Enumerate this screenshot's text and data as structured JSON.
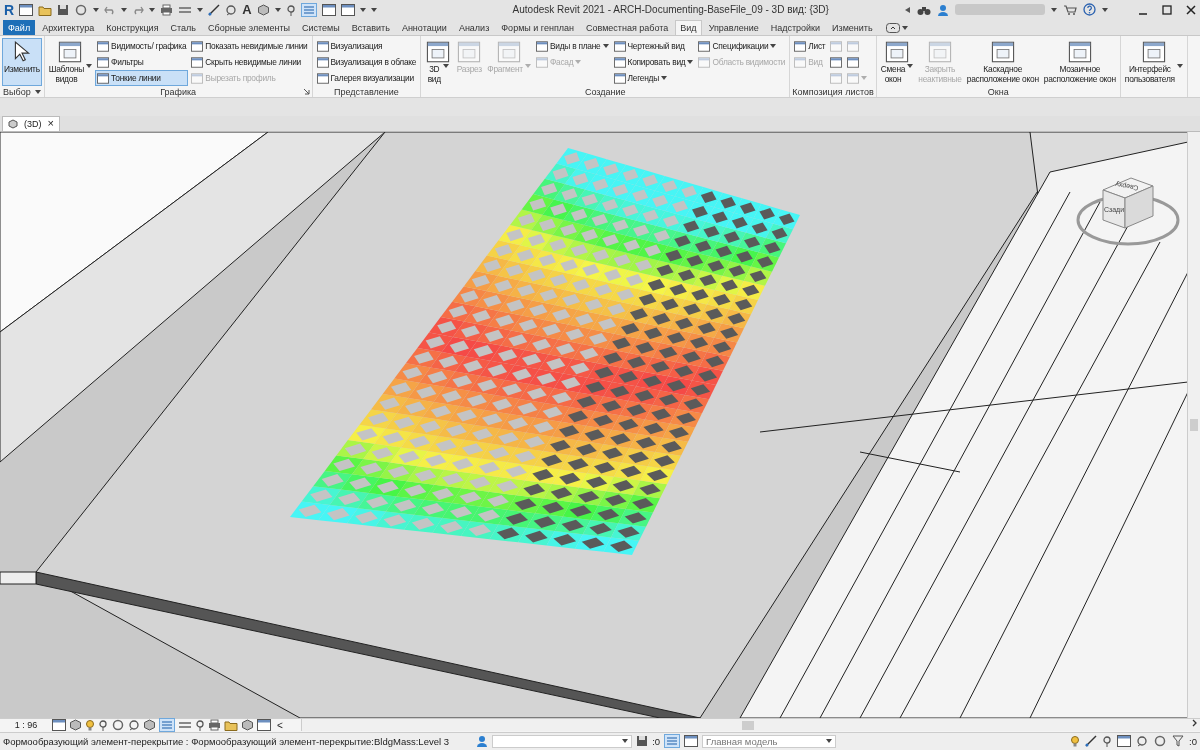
{
  "title_bar": {
    "logo": "R",
    "glyph": "A",
    "title": "Autodesk Revit 2021 - ARCH-Documenting-BaseFile_09 - 3D вид: {3D}"
  },
  "tabs": [
    {
      "kind": "file",
      "label": "Файл",
      "selected": false
    },
    {
      "kind": "tab",
      "label": "Архитектура",
      "selected": false
    },
    {
      "kind": "tab",
      "label": "Конструкция",
      "selected": false
    },
    {
      "kind": "tab",
      "label": "Сталь",
      "selected": false
    },
    {
      "kind": "tab",
      "label": "Сборные элементы",
      "selected": false
    },
    {
      "kind": "tab",
      "label": "Системы",
      "selected": false
    },
    {
      "kind": "tab",
      "label": "Вставить",
      "selected": false
    },
    {
      "kind": "tab",
      "label": "Аннотации",
      "selected": false
    },
    {
      "kind": "tab",
      "label": "Анализ",
      "selected": false
    },
    {
      "kind": "tab",
      "label": "Формы и генплан",
      "selected": false
    },
    {
      "kind": "tab",
      "label": "Совместная работа",
      "selected": false
    },
    {
      "kind": "tab",
      "label": "Вид",
      "selected": true
    },
    {
      "kind": "tab",
      "label": "Управление",
      "selected": false
    },
    {
      "kind": "tab",
      "label": "Надстройки",
      "selected": false
    },
    {
      "kind": "tab",
      "label": "Изменить",
      "selected": false
    }
  ],
  "ribbon": {
    "panels": [
      {
        "title": "Выбор",
        "menu": true,
        "launcher": false,
        "items": [
          {
            "kind": "large",
            "label": "Изменить",
            "active": true,
            "disabled": false,
            "dropdown": false
          }
        ]
      },
      {
        "title": "Графика",
        "menu": false,
        "launcher": true,
        "items": [
          {
            "kind": "large",
            "label": "Шаблоны\nвидов",
            "active": false,
            "disabled": false,
            "dropdown": true
          },
          {
            "kind": "stack",
            "buttons": [
              {
                "label": "Видимость/ графика",
                "active": false,
                "disabled": false,
                "dropdown": false
              },
              {
                "label": "Фильтры",
                "active": false,
                "disabled": false,
                "dropdown": false
              },
              {
                "label": "Тонкие линии",
                "active": true,
                "disabled": false,
                "dropdown": false
              }
            ]
          },
          {
            "kind": "stack",
            "buttons": [
              {
                "label": "Показать невидимые линии",
                "active": false,
                "disabled": false,
                "dropdown": false
              },
              {
                "label": "Скрыть невидимые линии",
                "active": false,
                "disabled": false,
                "dropdown": false
              },
              {
                "label": "Вырезать профиль",
                "active": false,
                "disabled": true,
                "dropdown": false
              }
            ]
          }
        ]
      },
      {
        "title": "Представление",
        "menu": false,
        "launcher": false,
        "items": [
          {
            "kind": "stack",
            "buttons": [
              {
                "label": "Визуализация",
                "active": false,
                "disabled": false,
                "dropdown": false
              },
              {
                "label": "Визуализация в облаке",
                "active": false,
                "disabled": false,
                "dropdown": false
              },
              {
                "label": "Галерея визуализации",
                "active": false,
                "disabled": false,
                "dropdown": false
              }
            ]
          }
        ]
      },
      {
        "title": "Создание",
        "menu": false,
        "launcher": false,
        "items": [
          {
            "kind": "large",
            "label": "3D\nвид",
            "active": false,
            "disabled": false,
            "dropdown": true
          },
          {
            "kind": "large",
            "label": "Разрез",
            "active": false,
            "disabled": true,
            "dropdown": false
          },
          {
            "kind": "large",
            "label": "Фрагмент",
            "active": false,
            "disabled": true,
            "dropdown": true
          },
          {
            "kind": "stack",
            "buttons": [
              {
                "label": "Виды в плане",
                "active": false,
                "disabled": false,
                "dropdown": true
              },
              {
                "label": "Фасад",
                "active": false,
                "disabled": true,
                "dropdown": true
              }
            ]
          },
          {
            "kind": "stack",
            "buttons": [
              {
                "label": "Чертежный вид",
                "active": false,
                "disabled": false,
                "dropdown": false
              },
              {
                "label": "Копировать вид",
                "active": false,
                "disabled": false,
                "dropdown": true
              },
              {
                "label": "Легенды",
                "active": false,
                "disabled": false,
                "dropdown": true
              }
            ]
          },
          {
            "kind": "stack",
            "buttons": [
              {
                "label": "Спецификации",
                "active": false,
                "disabled": false,
                "dropdown": true
              },
              {
                "label": "Область видимости",
                "active": false,
                "disabled": true,
                "dropdown": false
              }
            ]
          }
        ]
      },
      {
        "title": "Композиция листов",
        "menu": false,
        "launcher": false,
        "items": [
          {
            "kind": "stack",
            "buttons": [
              {
                "label": "Лист",
                "active": false,
                "disabled": false,
                "dropdown": false
              },
              {
                "label": "Вид",
                "active": false,
                "disabled": true,
                "dropdown": false
              }
            ]
          },
          {
            "kind": "stack",
            "buttons": [
              {
                "active": false,
                "disabled": true,
                "dropdown": false
              },
              {
                "active": false,
                "disabled": false,
                "dropdown": false
              },
              {
                "active": false,
                "disabled": true,
                "dropdown": false
              }
            ]
          },
          {
            "kind": "stack",
            "buttons": [
              {
                "active": false,
                "disabled": true,
                "dropdown": false
              },
              {
                "active": false,
                "disabled": false,
                "dropdown": false
              },
              {
                "active": false,
                "disabled": true,
                "dropdown": true
              }
            ]
          }
        ]
      },
      {
        "title": "Окна",
        "menu": false,
        "launcher": false,
        "items": [
          {
            "kind": "large",
            "label": "Смена\nокон",
            "active": false,
            "disabled": false,
            "dropdown": true
          },
          {
            "kind": "large",
            "label": "Закрыть\nнеактивные",
            "active": false,
            "disabled": true,
            "dropdown": false
          },
          {
            "kind": "large",
            "label": "Каскадное\nрасположение окон",
            "active": false,
            "disabled": false,
            "dropdown": false
          },
          {
            "kind": "large",
            "label": "Мозаичное\nрасположение окон",
            "active": false,
            "disabled": false,
            "dropdown": false
          }
        ]
      },
      {
        "items": [
          {
            "kind": "large",
            "label": "Интерфейс\nпользователя",
            "active": false,
            "disabled": false,
            "dropdown": true
          }
        ]
      }
    ]
  },
  "view_tabs": [
    {
      "label": "(3D)",
      "close": "×",
      "selected": true
    }
  ],
  "viewcube": {
    "top": "Сверху",
    "front": "Сзади"
  },
  "view_control_bar": {
    "scale": "1 : 96",
    "collapse": "<"
  },
  "status_bar": {
    "message": "Формообразующий элемент-перекрытие : Формообразующий элемент-перекрытие:BldgMass:Level 3",
    "workset_count": ":0",
    "design_option": "Главная модель",
    "filter_count": ":0"
  }
}
